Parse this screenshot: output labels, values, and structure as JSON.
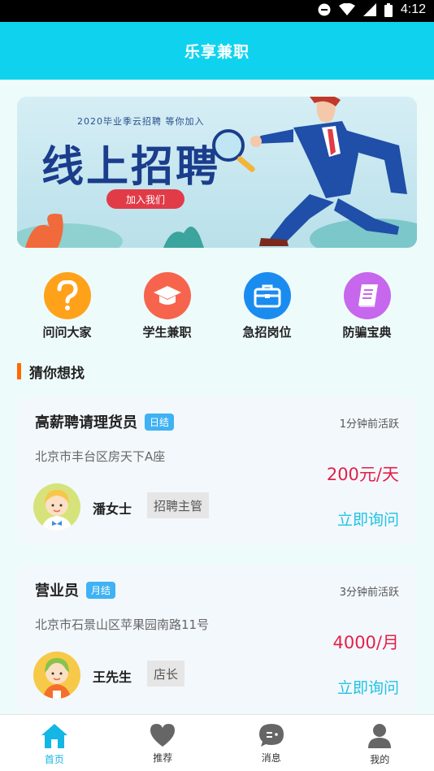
{
  "status_bar": {
    "time": "4:12",
    "icons": [
      "do-not-disturb-icon",
      "wifi-icon",
      "signal-icon",
      "battery-icon"
    ]
  },
  "header": {
    "title": "乐享兼职"
  },
  "banner": {
    "subtitle": "2020毕业季云招聘 等你加入",
    "title": "线上招聘",
    "button_label": "加入我们"
  },
  "quick_menu": [
    {
      "label": "问问大家",
      "icon": "question-icon",
      "color": "#ffa21a"
    },
    {
      "label": "学生兼职",
      "icon": "graduation-cap-icon",
      "color": "#f7644d"
    },
    {
      "label": "急招岗位",
      "icon": "briefcase-icon",
      "color": "#1a8cf0"
    },
    {
      "label": "防骗宝典",
      "icon": "book-icon",
      "color": "#c667ee"
    }
  ],
  "section": {
    "title": "猜你想找"
  },
  "jobs": [
    {
      "title": "高薪聘请理货员",
      "tag": "日结",
      "active": "1分钟前活跃",
      "address": "北京市丰台区房天下A座",
      "salary": "200元/天",
      "contact": "潘女士",
      "role": "招聘主管",
      "action": "立即询问"
    },
    {
      "title": "营业员",
      "tag": "月结",
      "active": "3分钟前活跃",
      "address": "北京市石景山区苹果园南路11号",
      "salary": "4000/月",
      "contact": "王先生",
      "role": "店长",
      "action": "立即询问"
    }
  ],
  "bottom_nav": [
    {
      "label": "首页",
      "icon": "home-icon",
      "active": true
    },
    {
      "label": "推荐",
      "icon": "heart-icon",
      "active": false
    },
    {
      "label": "消息",
      "icon": "message-icon",
      "active": false
    },
    {
      "label": "我的",
      "icon": "user-icon",
      "active": false
    }
  ],
  "colors": {
    "primary": "#0fd3ee",
    "accent_red": "#e42048",
    "link": "#1fc3e3",
    "tag_blue": "#3fb2f3",
    "section_bar": "#ff6a00"
  }
}
